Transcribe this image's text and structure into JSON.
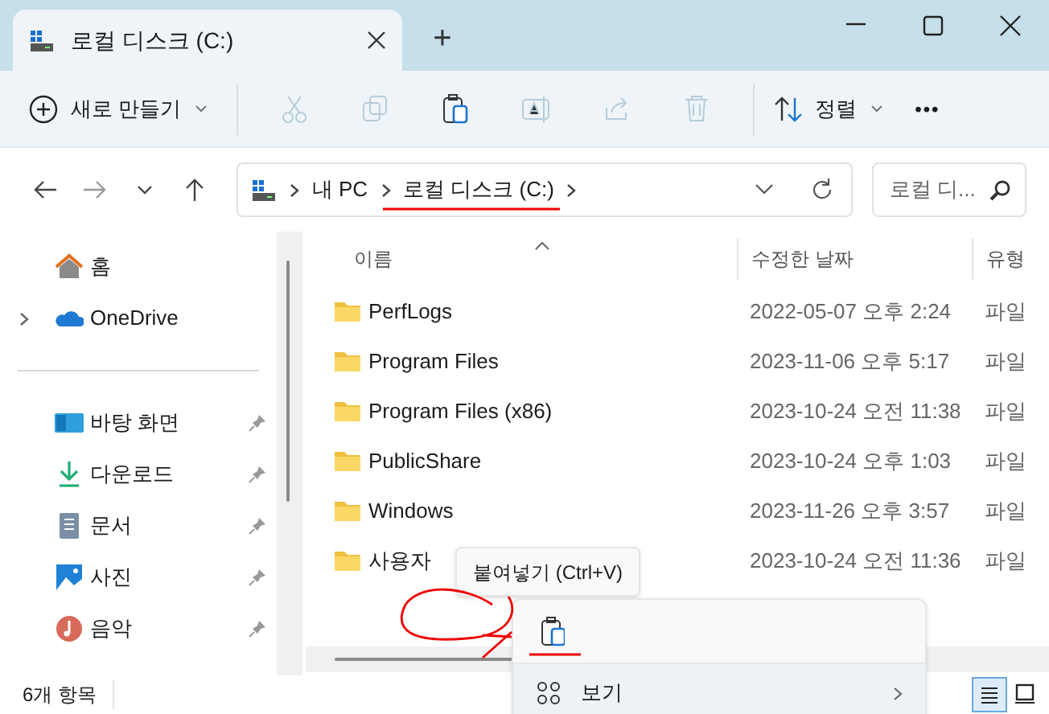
{
  "window": {
    "tab_title": "로컬 디스크 (C:)",
    "new_tab": "+"
  },
  "toolbar": {
    "new_label": "새로 만들기",
    "sort_label": "정렬",
    "more": "•••",
    "actions": [
      {
        "kind": "cut",
        "disabled": true
      },
      {
        "kind": "copy",
        "disabled": true
      },
      {
        "kind": "paste",
        "disabled": false
      },
      {
        "kind": "rename",
        "disabled": true
      },
      {
        "kind": "share",
        "disabled": true
      },
      {
        "kind": "delete",
        "disabled": true
      }
    ]
  },
  "address": {
    "crumbs": [
      {
        "label": "내 PC"
      },
      {
        "label": "로컬 디스크 (C:)"
      }
    ],
    "search_placeholder": "로컬 디..."
  },
  "sidebar": {
    "top": [
      {
        "label": "홈",
        "kind": "home",
        "expandable": false
      },
      {
        "label": "OneDrive",
        "kind": "cloud",
        "expandable": true
      }
    ],
    "pinned": [
      {
        "label": "바탕 화면",
        "kind": "desktop"
      },
      {
        "label": "다운로드",
        "kind": "download"
      },
      {
        "label": "문서",
        "kind": "document"
      },
      {
        "label": "사진",
        "kind": "picture"
      },
      {
        "label": "음악",
        "kind": "music"
      }
    ]
  },
  "table": {
    "columns": [
      "이름",
      "수정한 날짜",
      "유형"
    ],
    "rows": [
      {
        "name": "PerfLogs",
        "date": "2022-05-07 오후 2:24",
        "type": "파일"
      },
      {
        "name": "Program Files",
        "date": "2023-11-06 오후 5:17",
        "type": "파일"
      },
      {
        "name": "Program Files (x86)",
        "date": "2023-10-24 오전 11:38",
        "type": "파일"
      },
      {
        "name": "PublicShare",
        "date": "2023-10-24 오후 1:03",
        "type": "파일"
      },
      {
        "name": "Windows",
        "date": "2023-11-26 오후 3:57",
        "type": "파일"
      },
      {
        "name": "사용자",
        "date": "2023-10-24 오전 11:36",
        "type": "파일"
      }
    ]
  },
  "tooltip": "붙여넣기 (Ctrl+V)",
  "context_menu": {
    "items": [
      {
        "label": "보기"
      }
    ]
  },
  "status_bar": {
    "count": "6개 항목",
    "views": [
      {
        "kind": "details",
        "selected": true
      },
      {
        "kind": "tiles",
        "selected": false
      }
    ]
  }
}
